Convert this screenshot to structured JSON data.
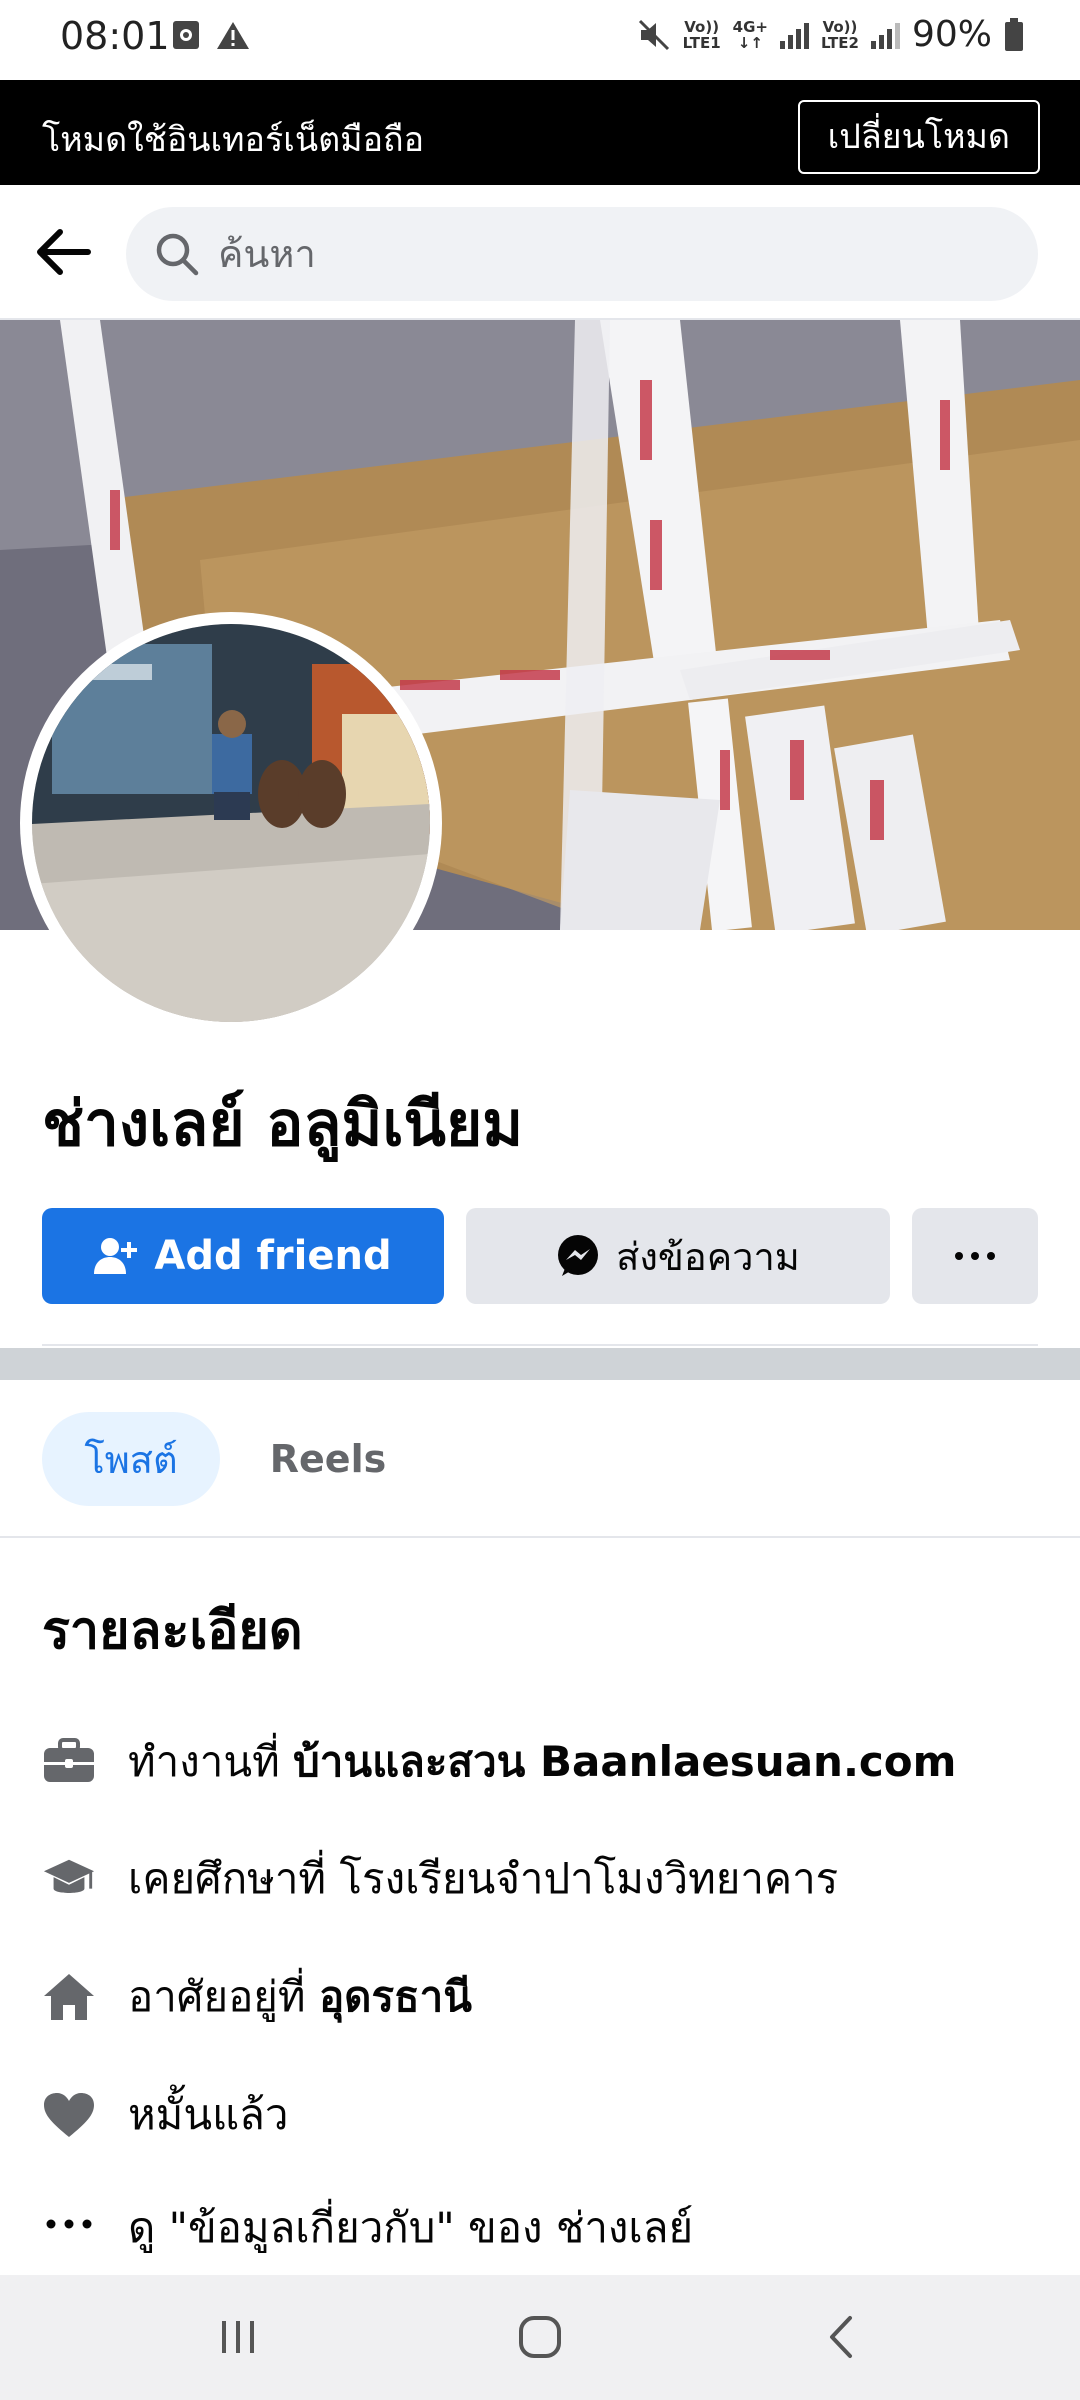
{
  "status_bar": {
    "time": "08:01",
    "net1_top": "Vo))",
    "net1_bottom": "LTE1",
    "net_type": "4G+",
    "net2_top": "Vo))",
    "net2_bottom": "LTE2",
    "battery": "90%"
  },
  "mode_banner": {
    "text": "โหมดใช้อินเทอร์เน็ตมือถือ",
    "button_label": "เปลี่ยนโหมด"
  },
  "search": {
    "placeholder": "ค้นหา"
  },
  "profile": {
    "name": "ช่างเลย์ อลูมิเนียม",
    "add_friend_label": "Add friend",
    "message_label": "ส่งข้อความ"
  },
  "tabs": [
    {
      "label": "โพสต์",
      "active": true
    },
    {
      "label": "Reels",
      "active": false
    }
  ],
  "details": {
    "title": "รายละเอียด",
    "work_prefix": "ทำงานที่ ",
    "work_place": "บ้านและสวน Baanlaesuan.com",
    "education": "เคยศึกษาที่ โรงเรียนจำปาโมงวิทยาคาร",
    "lives_prefix": "อาศัยอยู่ที่ ",
    "lives_place": "อุดรธานี",
    "relationship": "หมั้นแล้ว",
    "about_link": "ดู \"ข้อมูลเกี่ยวกับ\" ของ ช่างเลย์"
  },
  "icons": {
    "work": "briefcase-icon",
    "education": "graduation-cap-icon",
    "home": "home-icon",
    "relationship": "heart-icon",
    "more": "more-dots-icon"
  },
  "colors": {
    "primary": "#1b74e4",
    "tab_active_bg": "#e7f3ff",
    "button_grey": "#e4e6eb"
  }
}
